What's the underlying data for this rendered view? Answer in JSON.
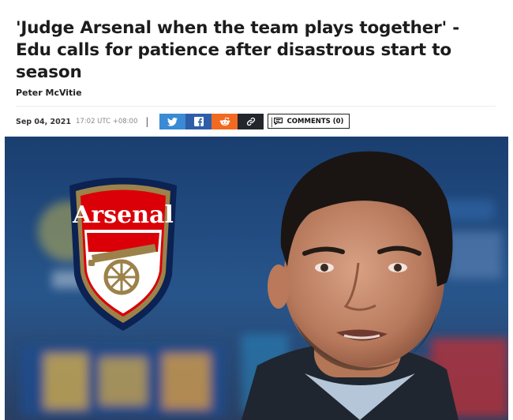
{
  "article": {
    "headline": "'Judge Arsenal when the team plays together' - Edu calls for patience after disastrous start to season",
    "author": "Peter McVitie",
    "date": "Sep 04, 2021",
    "time": "17:02 UTC +08:00",
    "comments_label": "COMMENTS (0)"
  },
  "share": {
    "icons": [
      {
        "name": "twitter-icon",
        "color": "#3a8ad6"
      },
      {
        "name": "facebook-icon",
        "color": "#2e5ea8"
      },
      {
        "name": "reddit-icon",
        "color": "#f26a21"
      },
      {
        "name": "link-icon",
        "color": "#23262b"
      }
    ]
  },
  "image": {
    "crest_text": "Arsenal",
    "crest_colors": {
      "red": "#db0007",
      "navy": "#0b2253",
      "gold": "#9c824a"
    },
    "background_color": "#1d3f6e"
  }
}
